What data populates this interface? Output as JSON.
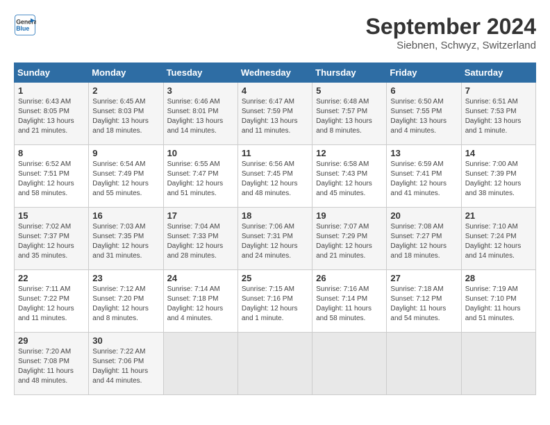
{
  "logo": {
    "line1": "General",
    "line2": "Blue"
  },
  "title": "September 2024",
  "location": "Siebnen, Schwyz, Switzerland",
  "weekdays": [
    "Sunday",
    "Monday",
    "Tuesday",
    "Wednesday",
    "Thursday",
    "Friday",
    "Saturday"
  ],
  "weeks": [
    [
      {
        "num": "1",
        "rise": "6:43 AM",
        "set": "8:05 PM",
        "daylight": "13 hours and 21 minutes."
      },
      {
        "num": "2",
        "rise": "6:45 AM",
        "set": "8:03 PM",
        "daylight": "13 hours and 18 minutes."
      },
      {
        "num": "3",
        "rise": "6:46 AM",
        "set": "8:01 PM",
        "daylight": "13 hours and 14 minutes."
      },
      {
        "num": "4",
        "rise": "6:47 AM",
        "set": "7:59 PM",
        "daylight": "13 hours and 11 minutes."
      },
      {
        "num": "5",
        "rise": "6:48 AM",
        "set": "7:57 PM",
        "daylight": "13 hours and 8 minutes."
      },
      {
        "num": "6",
        "rise": "6:50 AM",
        "set": "7:55 PM",
        "daylight": "13 hours and 4 minutes."
      },
      {
        "num": "7",
        "rise": "6:51 AM",
        "set": "7:53 PM",
        "daylight": "13 hours and 1 minute."
      }
    ],
    [
      {
        "num": "8",
        "rise": "6:52 AM",
        "set": "7:51 PM",
        "daylight": "12 hours and 58 minutes."
      },
      {
        "num": "9",
        "rise": "6:54 AM",
        "set": "7:49 PM",
        "daylight": "12 hours and 55 minutes."
      },
      {
        "num": "10",
        "rise": "6:55 AM",
        "set": "7:47 PM",
        "daylight": "12 hours and 51 minutes."
      },
      {
        "num": "11",
        "rise": "6:56 AM",
        "set": "7:45 PM",
        "daylight": "12 hours and 48 minutes."
      },
      {
        "num": "12",
        "rise": "6:58 AM",
        "set": "7:43 PM",
        "daylight": "12 hours and 45 minutes."
      },
      {
        "num": "13",
        "rise": "6:59 AM",
        "set": "7:41 PM",
        "daylight": "12 hours and 41 minutes."
      },
      {
        "num": "14",
        "rise": "7:00 AM",
        "set": "7:39 PM",
        "daylight": "12 hours and 38 minutes."
      }
    ],
    [
      {
        "num": "15",
        "rise": "7:02 AM",
        "set": "7:37 PM",
        "daylight": "12 hours and 35 minutes."
      },
      {
        "num": "16",
        "rise": "7:03 AM",
        "set": "7:35 PM",
        "daylight": "12 hours and 31 minutes."
      },
      {
        "num": "17",
        "rise": "7:04 AM",
        "set": "7:33 PM",
        "daylight": "12 hours and 28 minutes."
      },
      {
        "num": "18",
        "rise": "7:06 AM",
        "set": "7:31 PM",
        "daylight": "12 hours and 24 minutes."
      },
      {
        "num": "19",
        "rise": "7:07 AM",
        "set": "7:29 PM",
        "daylight": "12 hours and 21 minutes."
      },
      {
        "num": "20",
        "rise": "7:08 AM",
        "set": "7:27 PM",
        "daylight": "12 hours and 18 minutes."
      },
      {
        "num": "21",
        "rise": "7:10 AM",
        "set": "7:24 PM",
        "daylight": "12 hours and 14 minutes."
      }
    ],
    [
      {
        "num": "22",
        "rise": "7:11 AM",
        "set": "7:22 PM",
        "daylight": "12 hours and 11 minutes."
      },
      {
        "num": "23",
        "rise": "7:12 AM",
        "set": "7:20 PM",
        "daylight": "12 hours and 8 minutes."
      },
      {
        "num": "24",
        "rise": "7:14 AM",
        "set": "7:18 PM",
        "daylight": "12 hours and 4 minutes."
      },
      {
        "num": "25",
        "rise": "7:15 AM",
        "set": "7:16 PM",
        "daylight": "12 hours and 1 minute."
      },
      {
        "num": "26",
        "rise": "7:16 AM",
        "set": "7:14 PM",
        "daylight": "11 hours and 58 minutes."
      },
      {
        "num": "27",
        "rise": "7:18 AM",
        "set": "7:12 PM",
        "daylight": "11 hours and 54 minutes."
      },
      {
        "num": "28",
        "rise": "7:19 AM",
        "set": "7:10 PM",
        "daylight": "11 hours and 51 minutes."
      }
    ],
    [
      {
        "num": "29",
        "rise": "7:20 AM",
        "set": "7:08 PM",
        "daylight": "11 hours and 48 minutes."
      },
      {
        "num": "30",
        "rise": "7:22 AM",
        "set": "7:06 PM",
        "daylight": "11 hours and 44 minutes."
      },
      null,
      null,
      null,
      null,
      null
    ]
  ]
}
